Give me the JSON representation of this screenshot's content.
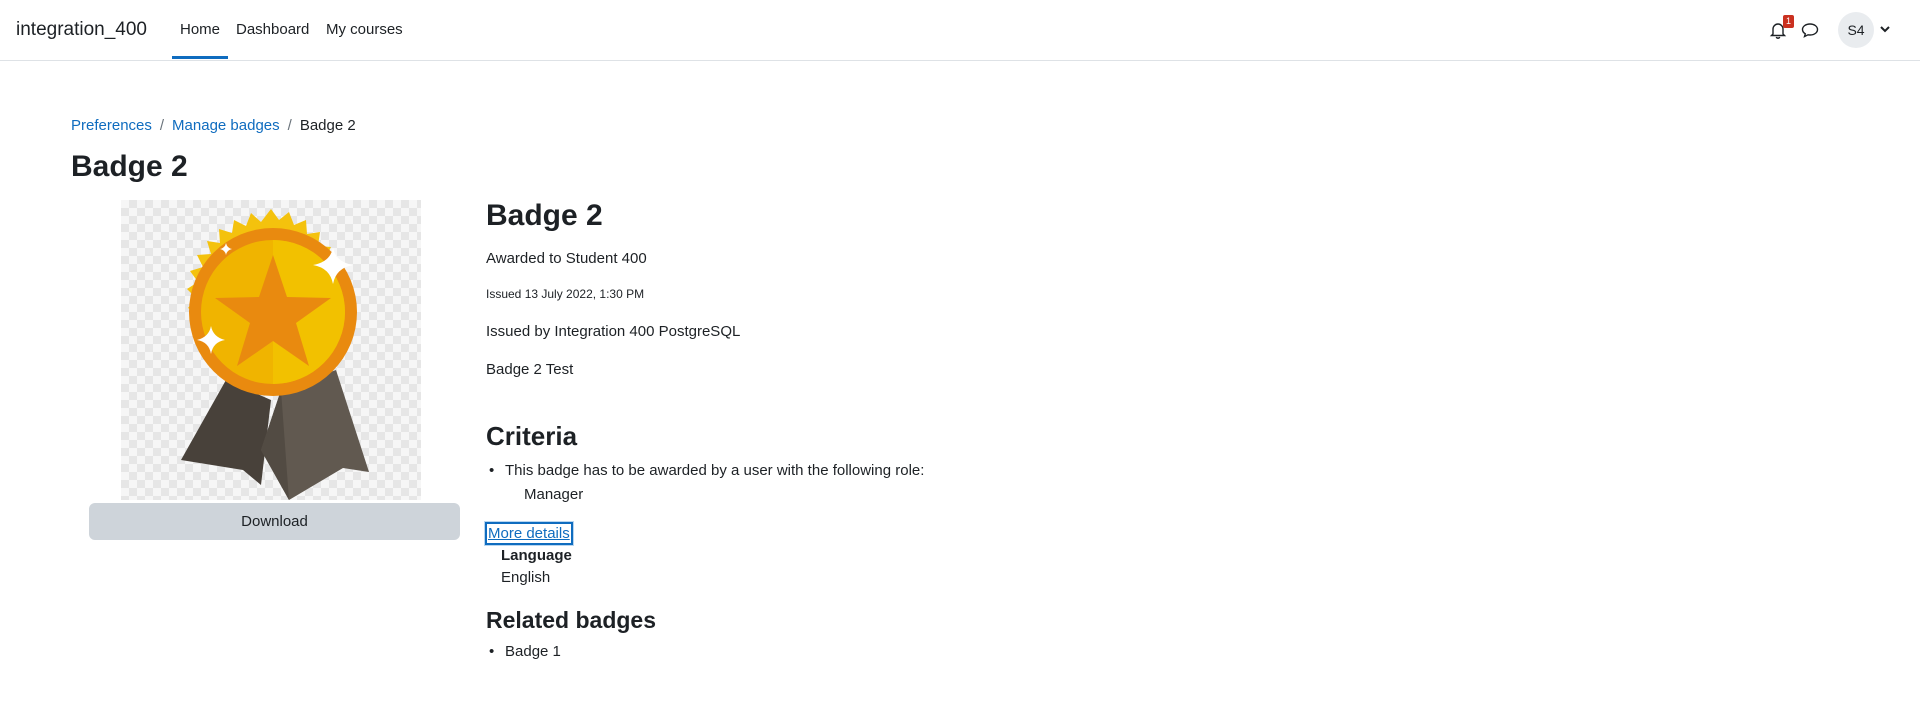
{
  "navbar": {
    "brand": "integration_400",
    "items": [
      {
        "label": "Home"
      },
      {
        "label": "Dashboard"
      },
      {
        "label": "My courses"
      }
    ],
    "notification_count": "1",
    "user_initials": "S4",
    "icons": [
      "bell-icon",
      "chat-icon",
      "chevron-down-icon"
    ],
    "accent_color": "#0f6cbf"
  },
  "breadcrumb": [
    {
      "label": "Preferences"
    },
    {
      "label": "Manage badges"
    },
    {
      "label": "Badge 2"
    }
  ],
  "page_title": "Badge 2",
  "badge": {
    "name": "Badge 2",
    "awarded_to": "Awarded to Student 400",
    "issued_date": "Issued 13 July 2022, 1:30 PM",
    "issued_by": "Issued by Integration 400 PostgreSQL",
    "description": "Badge 2 Test",
    "download_label": "Download"
  },
  "criteria": {
    "heading": "Criteria",
    "items": [
      {
        "text": "This badge has to be awarded by a user with the following role:",
        "role": "Manager"
      }
    ]
  },
  "more_details": {
    "link": "More details",
    "language_label": "Language",
    "language_value": "English"
  },
  "related": {
    "heading": "Related badges",
    "items": [
      "Badge 1"
    ]
  }
}
